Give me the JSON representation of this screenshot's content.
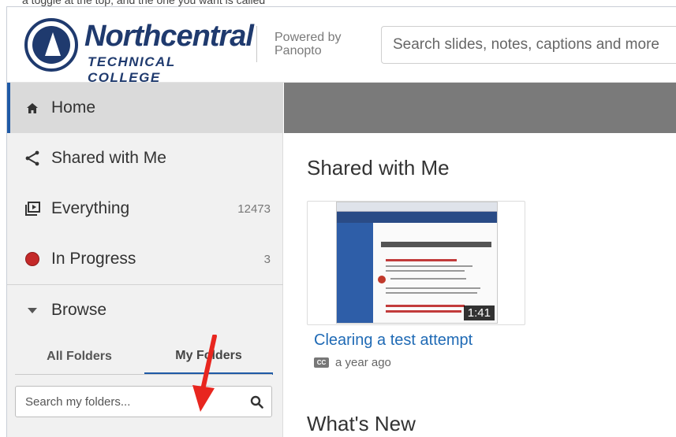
{
  "caption": "a toggle at the top, and the one you want is called",
  "header": {
    "college_name": "Northcentral",
    "college_sub": "TECHNICAL COLLEGE",
    "powered_by": "Powered by",
    "powered_brand": "Panopto",
    "search_placeholder": "Search slides, notes, captions and more"
  },
  "sidebar": {
    "items": [
      {
        "label": "Home",
        "icon": "home-icon"
      },
      {
        "label": "Shared with Me",
        "icon": "share-icon"
      },
      {
        "label": "Everything",
        "icon": "library-icon",
        "count": "12473"
      },
      {
        "label": "In Progress",
        "icon": "record-dot-icon",
        "count": "3"
      },
      {
        "label": "Browse",
        "icon": "caret-down-icon"
      }
    ],
    "tabs": [
      {
        "label": "All Folders"
      },
      {
        "label": "My Folders",
        "active": true
      }
    ],
    "folder_search_placeholder": "Search my folders..."
  },
  "main": {
    "sections": [
      "Shared with Me",
      "What's New"
    ],
    "video": {
      "title": "Clearing a test attempt",
      "duration": "1:41",
      "age": "a year ago"
    }
  },
  "colors": {
    "brand_navy": "#1f3a6e",
    "link_blue": "#1f6ab5",
    "active_accent": "#1f5aa6",
    "annotation_red": "#e8261f"
  }
}
